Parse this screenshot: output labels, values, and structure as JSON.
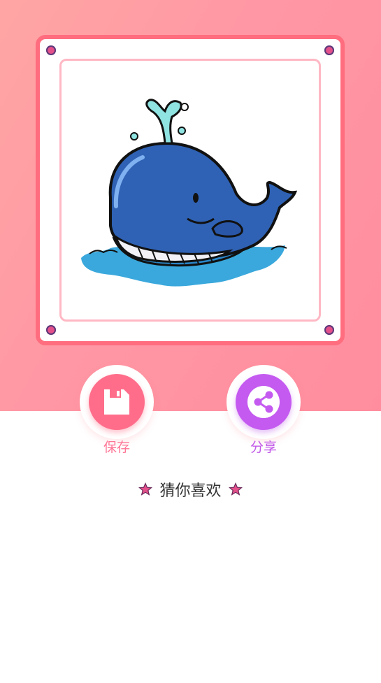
{
  "actions": {
    "save_label": "保存",
    "share_label": "分享"
  },
  "section": {
    "title": "猜你喜欢"
  },
  "icons": {
    "save": "floppy-disk-icon",
    "share": "share-icon",
    "star": "star-icon"
  },
  "colors": {
    "background_gradient_start": "#ffa6a4",
    "background_gradient_end": "#ff8d9e",
    "frame_border": "#ff6d7e",
    "save_button": "#ff6d8a",
    "share_button": "#c45af0",
    "star": "#e4508a"
  }
}
